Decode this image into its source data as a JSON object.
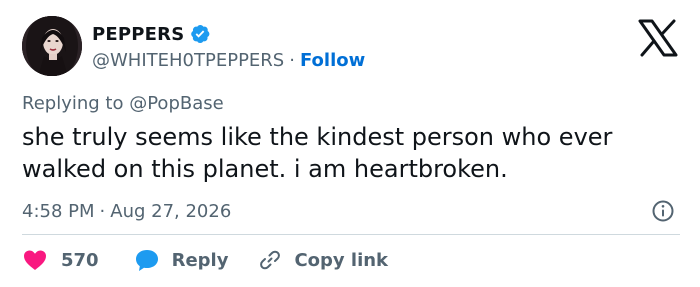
{
  "author": {
    "display_name": "PEPPERS",
    "handle": "@WHITEH0TPEPPERS",
    "separator": "·",
    "follow_label": "Follow",
    "verified_color": "#1d9bf0",
    "avatar_icon": "profile-photo"
  },
  "platform": {
    "logo": "x-logo"
  },
  "reply_context": {
    "prefix": "Replying to",
    "mention": "@PopBase"
  },
  "tweet": {
    "text": "she truly seems like the kindest person who ever\nwalked on this planet. i am heartbroken."
  },
  "meta": {
    "time": "4:58 PM",
    "separator": "·",
    "date": "Aug 27, 2026",
    "info_icon": "info-icon"
  },
  "actions": {
    "like_count": "570",
    "like_color": "#f91880",
    "reply_label": "Reply",
    "reply_color": "#1d9bf0",
    "copy_link_label": "Copy link"
  }
}
